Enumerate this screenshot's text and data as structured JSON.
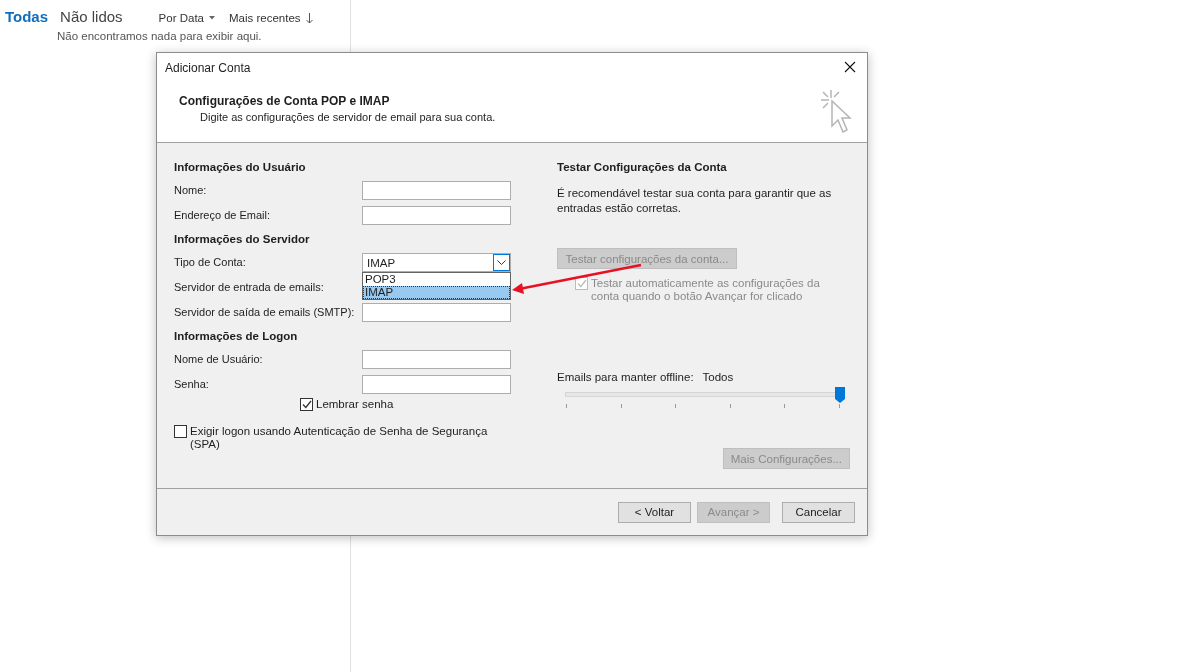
{
  "mail_list": {
    "filters": [
      {
        "label": "Todas",
        "selected": true
      },
      {
        "label": "Não lidos",
        "selected": false
      }
    ],
    "sort": {
      "by": "Por Data",
      "order": "Mais recentes"
    },
    "empty_message": "Não encontramos nada para exibir aqui."
  },
  "dialog": {
    "title": "Adicionar Conta",
    "heading": "Configurações de Conta POP e IMAP",
    "subheading": "Digite as configurações de servidor de email para sua conta.",
    "sections": [
      {
        "title": "Informações do Usuário",
        "fields": [
          {
            "kind": "text",
            "label": "Nome:"
          },
          {
            "kind": "text",
            "label": "Endereço de Email:"
          }
        ]
      },
      {
        "title": "Informações do Servidor",
        "fields": [
          {
            "kind": "select",
            "label": "Tipo de Conta:",
            "value": "IMAP",
            "expanded": true,
            "options": [
              {
                "label": "POP3",
                "selected": false
              },
              {
                "label": "IMAP",
                "selected": true
              }
            ]
          },
          {
            "kind": "text",
            "label": "Servidor de entrada de emails:"
          },
          {
            "kind": "text",
            "label": "Servidor de saída de emails (SMTP):"
          }
        ]
      },
      {
        "title": "Informações de Logon",
        "fields": [
          {
            "kind": "text",
            "label": "Nome de Usuário:"
          },
          {
            "kind": "text",
            "label": "Senha:"
          }
        ]
      }
    ],
    "remember_password": {
      "label": "Lembrar senha",
      "checked": true
    },
    "spa": {
      "label": "Exigir logon usando Autenticação de Senha de Segurança (SPA)",
      "checked": false
    },
    "test": {
      "title": "Testar Configurações da Conta",
      "description": "É recomendável testar sua conta para garantir que as entradas estão corretas.",
      "button": {
        "label": "Testar configurações da conta...",
        "disabled": true
      },
      "auto_test": {
        "label": "Testar automaticamente as configurações da conta quando o botão Avançar for clicado",
        "checked": true,
        "disabled": true
      }
    },
    "offline": {
      "label": "Emails para manter offline:",
      "value": "Todos",
      "level": 1
    },
    "more_button": {
      "label": "Mais Configurações...",
      "disabled": true
    },
    "footer_buttons": [
      {
        "label": "< Voltar",
        "disabled": false
      },
      {
        "label": "Avançar >",
        "disabled": true
      },
      {
        "label": "Cancelar",
        "disabled": false
      }
    ]
  }
}
